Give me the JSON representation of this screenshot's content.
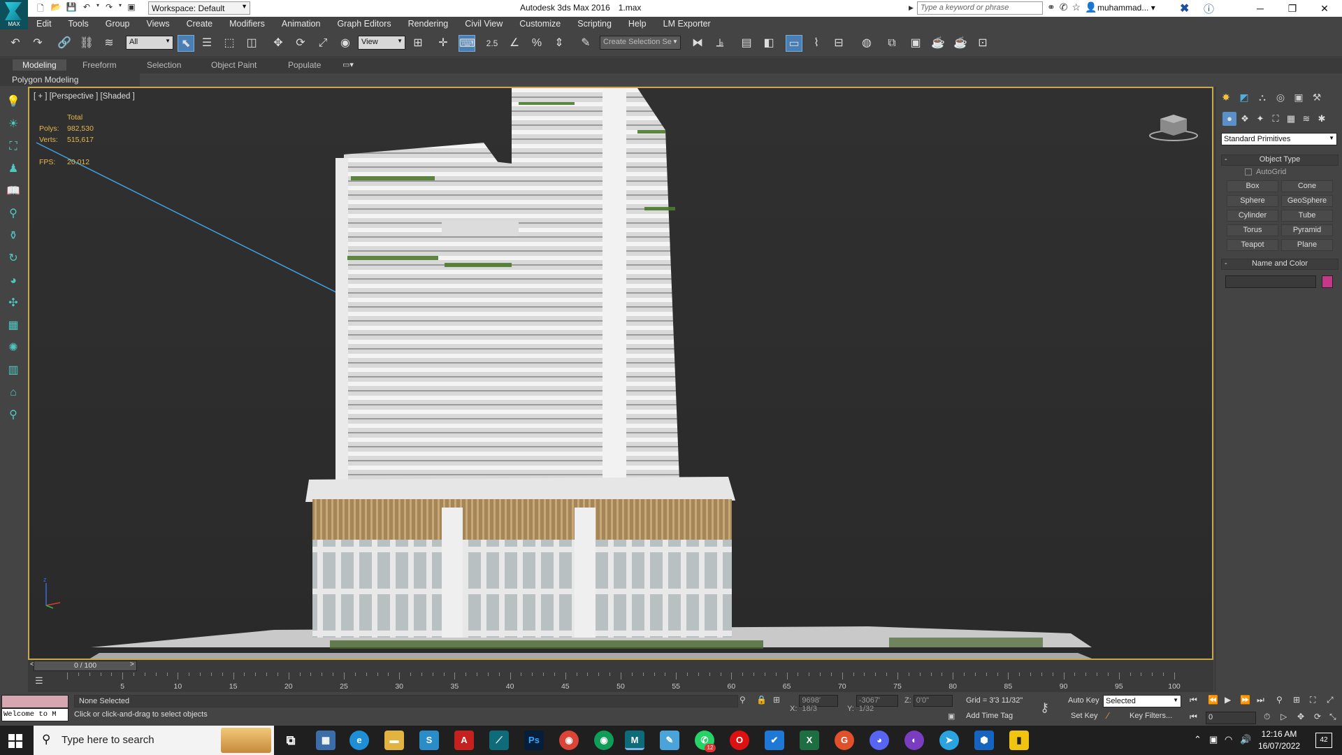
{
  "titlebar": {
    "logo_text": "MAX",
    "workspace": "Workspace: Default",
    "app_title": "Autodesk 3ds Max 2016",
    "file_name": "1.max",
    "search_placeholder": "Type a keyword or phrase",
    "user": "muhammad..."
  },
  "menu": [
    "Edit",
    "Tools",
    "Group",
    "Views",
    "Create",
    "Modifiers",
    "Animation",
    "Graph Editors",
    "Rendering",
    "Civil View",
    "Customize",
    "Scripting",
    "Help",
    "LM Exporter"
  ],
  "toolbar": {
    "selection_filter": "All",
    "ref_coord": "View",
    "snap_value": "2.5",
    "selection_set_placeholder": "Create Selection Se"
  },
  "ribbon": {
    "tabs": [
      "Modeling",
      "Freeform",
      "Selection",
      "Object Paint",
      "Populate"
    ],
    "active_tab": "Modeling",
    "panel": "Polygon Modeling"
  },
  "viewport": {
    "label": "[ + ] [Perspective ] [Shaded ]",
    "stats": {
      "header": "Total",
      "polys_label": "Polys:",
      "polys": "982,530",
      "verts_label": "Verts:",
      "verts": "515,617",
      "fps_label": "FPS:",
      "fps": "20.012"
    }
  },
  "timeline": {
    "frame": "0 / 100",
    "ticks": [
      5,
      10,
      15,
      20,
      25,
      30,
      35,
      40,
      45,
      50,
      55,
      60,
      65,
      70,
      75,
      80,
      85,
      90,
      95,
      100
    ]
  },
  "status": {
    "listener": "Welcome to M",
    "selection": "None Selected",
    "prompt": "Click or click-and-drag to select objects",
    "x_label": "X:",
    "x": "9698' 18/3",
    "y_label": "Y:",
    "y": "-3067' 1/32",
    "z_label": "Z:",
    "z": "0'0\"",
    "grid": "Grid = 3'3 11/32\"",
    "add_time_tag": "Add Time Tag",
    "auto_key": "Auto Key",
    "set_key": "Set Key",
    "key_mode": "Selected",
    "key_filters": "Key Filters...",
    "current_frame": "0"
  },
  "command_panel": {
    "category": "Standard Primitives",
    "object_type_title": "Object Type",
    "autogrid": "AutoGrid",
    "buttons": [
      "Box",
      "Cone",
      "Sphere",
      "GeoSphere",
      "Cylinder",
      "Tube",
      "Torus",
      "Pyramid",
      "Teapot",
      "Plane"
    ],
    "name_color_title": "Name and Color",
    "color": "#c4388a"
  },
  "taskbar": {
    "search_text": "Type here to search",
    "time": "12:16 AM",
    "date": "16/07/2022",
    "notifications": "42",
    "whatsapp_badge": "12"
  }
}
